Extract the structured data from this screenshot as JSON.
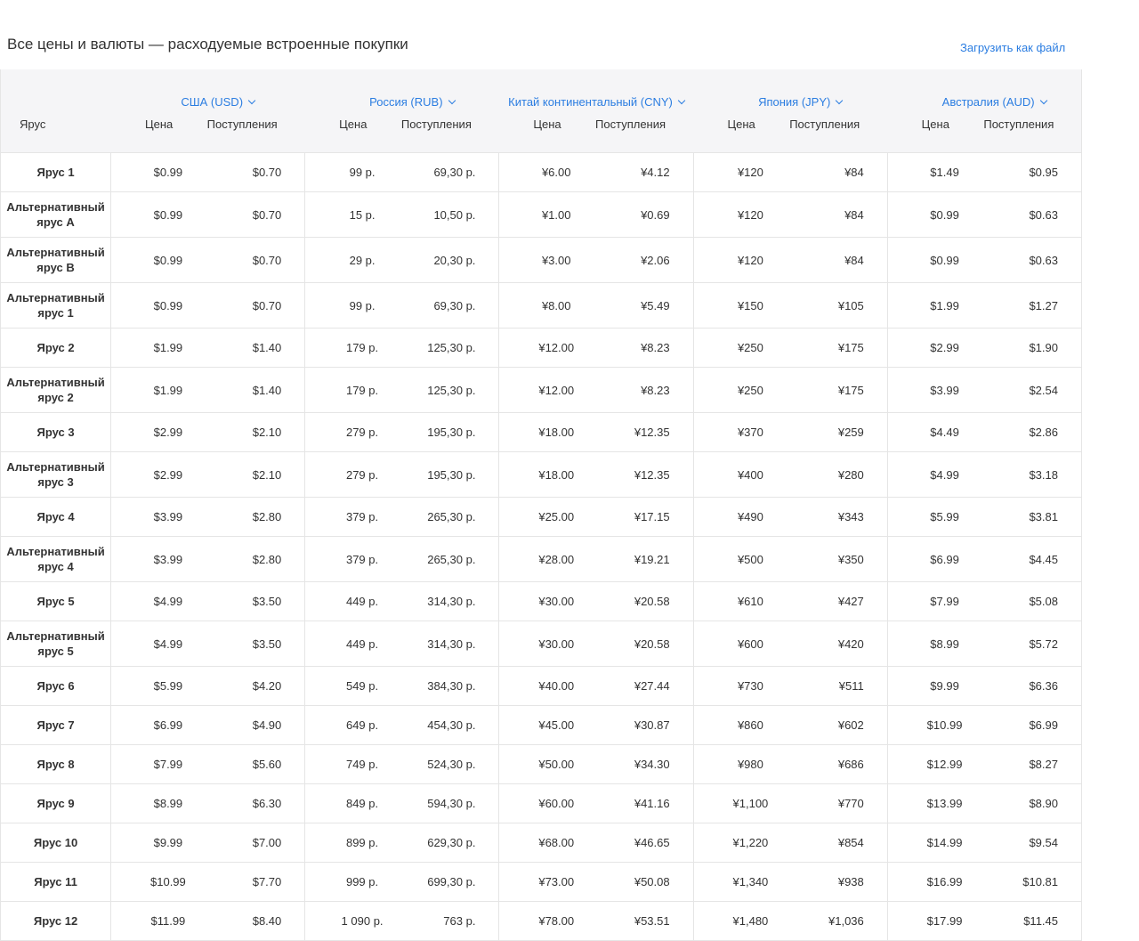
{
  "page": {
    "title": "Все цены и валюты — расходуемые встроенные покупки",
    "download_label": "Загрузить как файл"
  },
  "table": {
    "tier_header": "Ярус",
    "currencies": [
      {
        "name": "США (USD)",
        "price_label": "Цена",
        "proceeds_label": "Поступления"
      },
      {
        "name": "Россия (RUB)",
        "price_label": "Цена",
        "proceeds_label": "Поступления"
      },
      {
        "name": "Китай континентальный (CNY)",
        "price_label": "Цена",
        "proceeds_label": "Поступления"
      },
      {
        "name": "Япония (JPY)",
        "price_label": "Цена",
        "proceeds_label": "Поступления"
      },
      {
        "name": "Австралия (AUD)",
        "price_label": "Цена",
        "proceeds_label": "Поступления"
      }
    ],
    "rows": [
      {
        "tier": "Ярус 1",
        "values": [
          "$0.99",
          "$0.70",
          "99 р.",
          "69,30 р.",
          "¥6.00",
          "¥4.12",
          "¥120",
          "¥84",
          "$1.49",
          "$0.95"
        ]
      },
      {
        "tier": "Альтернативный ярус A",
        "values": [
          "$0.99",
          "$0.70",
          "15 р.",
          "10,50 р.",
          "¥1.00",
          "¥0.69",
          "¥120",
          "¥84",
          "$0.99",
          "$0.63"
        ]
      },
      {
        "tier": "Альтернативный ярус B",
        "values": [
          "$0.99",
          "$0.70",
          "29 р.",
          "20,30 р.",
          "¥3.00",
          "¥2.06",
          "¥120",
          "¥84",
          "$0.99",
          "$0.63"
        ]
      },
      {
        "tier": "Альтернативный ярус 1",
        "values": [
          "$0.99",
          "$0.70",
          "99 р.",
          "69,30 р.",
          "¥8.00",
          "¥5.49",
          "¥150",
          "¥105",
          "$1.99",
          "$1.27"
        ]
      },
      {
        "tier": "Ярус 2",
        "values": [
          "$1.99",
          "$1.40",
          "179 р.",
          "125,30 р.",
          "¥12.00",
          "¥8.23",
          "¥250",
          "¥175",
          "$2.99",
          "$1.90"
        ]
      },
      {
        "tier": "Альтернативный ярус 2",
        "values": [
          "$1.99",
          "$1.40",
          "179 р.",
          "125,30 р.",
          "¥12.00",
          "¥8.23",
          "¥250",
          "¥175",
          "$3.99",
          "$2.54"
        ]
      },
      {
        "tier": "Ярус 3",
        "values": [
          "$2.99",
          "$2.10",
          "279 р.",
          "195,30 р.",
          "¥18.00",
          "¥12.35",
          "¥370",
          "¥259",
          "$4.49",
          "$2.86"
        ]
      },
      {
        "tier": "Альтернативный ярус 3",
        "values": [
          "$2.99",
          "$2.10",
          "279 р.",
          "195,30 р.",
          "¥18.00",
          "¥12.35",
          "¥400",
          "¥280",
          "$4.99",
          "$3.18"
        ]
      },
      {
        "tier": "Ярус 4",
        "values": [
          "$3.99",
          "$2.80",
          "379 р.",
          "265,30 р.",
          "¥25.00",
          "¥17.15",
          "¥490",
          "¥343",
          "$5.99",
          "$3.81"
        ]
      },
      {
        "tier": "Альтернативный ярус 4",
        "values": [
          "$3.99",
          "$2.80",
          "379 р.",
          "265,30 р.",
          "¥28.00",
          "¥19.21",
          "¥500",
          "¥350",
          "$6.99",
          "$4.45"
        ]
      },
      {
        "tier": "Ярус 5",
        "values": [
          "$4.99",
          "$3.50",
          "449 р.",
          "314,30 р.",
          "¥30.00",
          "¥20.58",
          "¥610",
          "¥427",
          "$7.99",
          "$5.08"
        ]
      },
      {
        "tier": "Альтернативный ярус 5",
        "values": [
          "$4.99",
          "$3.50",
          "449 р.",
          "314,30 р.",
          "¥30.00",
          "¥20.58",
          "¥600",
          "¥420",
          "$8.99",
          "$5.72"
        ]
      },
      {
        "tier": "Ярус 6",
        "values": [
          "$5.99",
          "$4.20",
          "549 р.",
          "384,30 р.",
          "¥40.00",
          "¥27.44",
          "¥730",
          "¥511",
          "$9.99",
          "$6.36"
        ]
      },
      {
        "tier": "Ярус 7",
        "values": [
          "$6.99",
          "$4.90",
          "649 р.",
          "454,30 р.",
          "¥45.00",
          "¥30.87",
          "¥860",
          "¥602",
          "$10.99",
          "$6.99"
        ]
      },
      {
        "tier": "Ярус 8",
        "values": [
          "$7.99",
          "$5.60",
          "749 р.",
          "524,30 р.",
          "¥50.00",
          "¥34.30",
          "¥980",
          "¥686",
          "$12.99",
          "$8.27"
        ]
      },
      {
        "tier": "Ярус 9",
        "values": [
          "$8.99",
          "$6.30",
          "849 р.",
          "594,30 р.",
          "¥60.00",
          "¥41.16",
          "¥1,100",
          "¥770",
          "$13.99",
          "$8.90"
        ]
      },
      {
        "tier": "Ярус 10",
        "values": [
          "$9.99",
          "$7.00",
          "899 р.",
          "629,30 р.",
          "¥68.00",
          "¥46.65",
          "¥1,220",
          "¥854",
          "$14.99",
          "$9.54"
        ]
      },
      {
        "tier": "Ярус 11",
        "values": [
          "$10.99",
          "$7.70",
          "999 р.",
          "699,30 р.",
          "¥73.00",
          "¥50.08",
          "¥1,340",
          "¥938",
          "$16.99",
          "$10.81"
        ]
      },
      {
        "tier": "Ярус 12",
        "values": [
          "$11.99",
          "$8.40",
          "1 090 р.",
          "763 р.",
          "¥78.00",
          "¥53.51",
          "¥1,480",
          "¥1,036",
          "$17.99",
          "$11.45"
        ]
      }
    ]
  }
}
